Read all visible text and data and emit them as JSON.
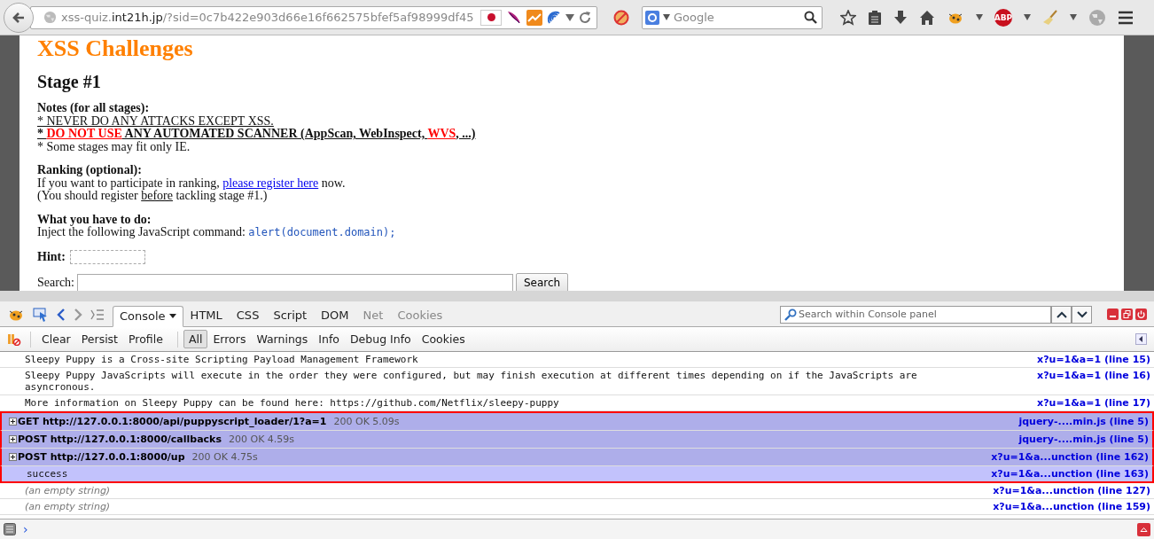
{
  "browser": {
    "url": {
      "prefix": "xss-quiz.",
      "host": "int21h.jp",
      "path": "/?sid=0c7b422e903d66e16f662575bfef5af98999df45"
    },
    "search_placeholder": "Google",
    "adblock_label": "ABP"
  },
  "page": {
    "title": "XSS Challenges",
    "stage": "Stage #1",
    "notes": {
      "heading": "Notes (for all stages):",
      "lines": [
        [
          {
            "text": "* NEVER DO ANY ATTACKS EXCEPT XSS.",
            "kind": "underline"
          }
        ],
        [
          {
            "text": "* ",
            "kind": "strong"
          },
          {
            "text": "DO NOT USE",
            "kind": "alert"
          },
          {
            "text": " ANY AUTOMATED SCANNER (AppScan, WebInspect, ",
            "kind": "strong"
          },
          {
            "text": "WVS",
            "kind": "alert"
          },
          {
            "text": ", ...)",
            "kind": "strong"
          }
        ],
        [
          {
            "text": "* Some stages may fit only IE.",
            "kind": "plain"
          }
        ]
      ]
    },
    "ranking": {
      "heading": "Ranking (optional):",
      "lines": [
        [
          {
            "text": "If you want to participate in ranking, ",
            "kind": "plain"
          },
          {
            "text": "please register here",
            "kind": "link"
          },
          {
            "text": " now.",
            "kind": "plain"
          }
        ],
        [
          {
            "text": "(You should register ",
            "kind": "plain"
          },
          {
            "text": "before",
            "kind": "underline"
          },
          {
            "text": " tackling stage #1.)",
            "kind": "plain"
          }
        ]
      ]
    },
    "task": {
      "heading": "What you have to do:",
      "text": "Inject the following JavaScript command: ",
      "code": "alert(document.domain);"
    },
    "hint_label": "Hint:",
    "search_label": "Search:",
    "search_button": "Search"
  },
  "devtools": {
    "tabs": [
      {
        "label": "Console",
        "selected": true,
        "disabled": false
      },
      {
        "label": "HTML",
        "selected": false,
        "disabled": false
      },
      {
        "label": "CSS",
        "selected": false,
        "disabled": false
      },
      {
        "label": "Script",
        "selected": false,
        "disabled": false
      },
      {
        "label": "DOM",
        "selected": false,
        "disabled": false
      },
      {
        "label": "Net",
        "selected": false,
        "disabled": true
      },
      {
        "label": "Cookies",
        "selected": false,
        "disabled": true
      }
    ],
    "search_placeholder": "Search within Console panel",
    "actions": [
      "Clear",
      "Persist",
      "Profile"
    ],
    "filters": [
      {
        "label": "All",
        "selected": true
      },
      {
        "label": "Errors",
        "selected": false
      },
      {
        "label": "Warnings",
        "selected": false
      },
      {
        "label": "Info",
        "selected": false
      },
      {
        "label": "Debug Info",
        "selected": false
      },
      {
        "label": "Cookies",
        "selected": false
      }
    ],
    "rows": [
      {
        "kind": "log",
        "text": "Sleepy Puppy is a Cross-site Scripting Payload Management Framework",
        "source": "x?u=1&a=1 (line 15)",
        "highlighted": false
      },
      {
        "kind": "log",
        "text": "Sleepy Puppy JavaScripts will execute in the order they were configured, but may finish execution at different times depending on if the JavaScripts are asyncronous.",
        "source": "x?u=1&a=1 (line 16)",
        "highlighted": false
      },
      {
        "kind": "log",
        "text": "More information on Sleepy Puppy can be found here: https://github.com/Netflix/sleepy-puppy",
        "source": "x?u=1&a=1 (line 17)",
        "highlighted": false
      },
      {
        "kind": "request",
        "text": "GET http://127.0.0.1:8000/api/puppyscript_loader/1?a=1",
        "status": "200 OK 5.09s",
        "source": "jquery-....min.js (line 5)",
        "highlighted": true
      },
      {
        "kind": "request",
        "text": "POST http://127.0.0.1:8000/callbacks",
        "status": "200 OK 4.59s",
        "source": "jquery-....min.js (line 5)",
        "highlighted": true
      },
      {
        "kind": "request",
        "text": "POST http://127.0.0.1:8000/up",
        "status": "200 OK 4.75s",
        "source": "x?u=1&a...unction (line 162)",
        "highlighted": true
      },
      {
        "kind": "result",
        "text": "success",
        "source": "x?u=1&a...unction (line 163)",
        "highlighted": true
      },
      {
        "kind": "empty",
        "text": "(an empty string)",
        "source": "x?u=1&a...unction (line 127)",
        "highlighted": false
      },
      {
        "kind": "empty",
        "text": "(an empty string)",
        "source": "x?u=1&a...unction (line 159)",
        "highlighted": false
      }
    ],
    "prompt": "›"
  }
}
